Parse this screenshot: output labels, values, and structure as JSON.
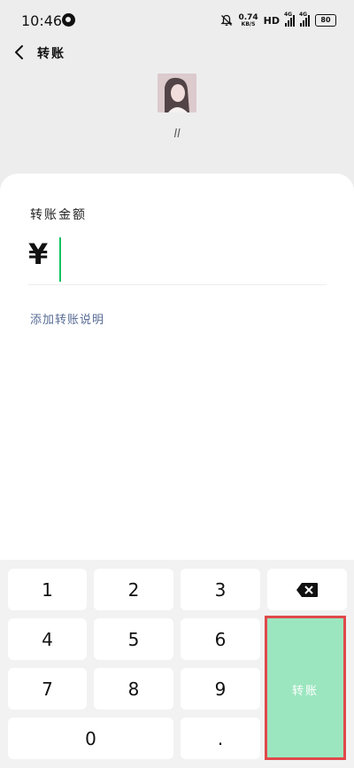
{
  "status_bar": {
    "time": "10:46",
    "speed_value": "0.74",
    "speed_unit": "KB/S",
    "hd_label": "HD",
    "network_1": "4G",
    "network_2": "4G",
    "battery": "80"
  },
  "nav": {
    "title": "转账",
    "back_icon": "chevron-left-icon"
  },
  "recipient": {
    "nickname": "ll"
  },
  "form": {
    "amount_label": "转账金额",
    "currency_symbol": "¥",
    "amount_value": "",
    "add_note_label": "添加转账说明"
  },
  "keypad": {
    "keys": [
      "1",
      "2",
      "3",
      "4",
      "5",
      "6",
      "7",
      "8",
      "9",
      "0",
      "."
    ],
    "delete_icon": "backspace-icon",
    "transfer_label": "转账"
  },
  "colors": {
    "accent_green": "#07c160",
    "transfer_button_disabled": "#9be6bf",
    "link_blue": "#576b95",
    "highlight_red": "#e0494a"
  }
}
